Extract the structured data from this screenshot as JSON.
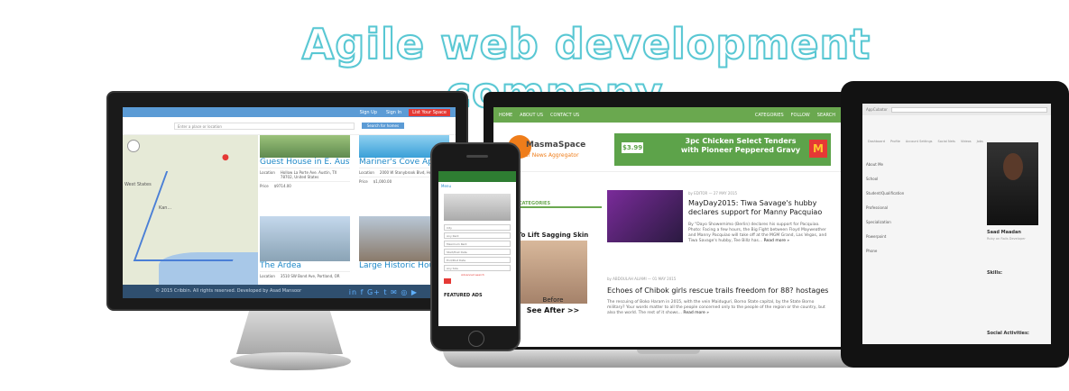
{
  "headline": "Agile web development company....",
  "monitor": {
    "nav_links": [
      "Sign Up",
      "Sign In"
    ],
    "nav_cta": "List Your Space",
    "search_placeholder": "Enter a place or location",
    "search_button": "Search for homes",
    "map_labels": [
      "West States",
      "Kan..."
    ],
    "listings": [
      {
        "title": "Guest House in E. Austin",
        "location_label": "Location",
        "location": "Hollow La Porte Ave. Austin, TX 78702, United States",
        "price_label": "Price",
        "price": "$9714.00"
      },
      {
        "title": "Mariner's Cove Apartments",
        "location_label": "Location",
        "location": "2000 W Stonybrook Blvd, Houston, TX",
        "price_label": "Price",
        "price": "$1,000.00"
      },
      {
        "title": "The Ardea",
        "location_label": "Location",
        "location": "3510 SW Bond Ave, Portland, OR",
        "price_label": "",
        "price": ""
      },
      {
        "title": "Large Historic House in...",
        "location_label": "",
        "location": "",
        "price_label": "",
        "price": ""
      }
    ],
    "footer_text": "© 2015 Cribbin. All rights reserved. Developed by Asad Mansoor",
    "social": "in f G+ t ✉ ◎ ▶"
  },
  "laptop": {
    "nav_left": [
      "HOME",
      "ABOUT US",
      "CONTACT US"
    ],
    "nav_right": [
      "CATEGORIES",
      "FOLLOW",
      "SEARCH"
    ],
    "brand": "MasmaSpace",
    "tagline": "Your News Aggregator",
    "ad_price": "$3.99",
    "ad_text": "3pc Chicken Select Tenders with Pioneer Peppered Gravy",
    "ad_logo": "M",
    "sidebar_heading": "CATEGORIES",
    "article1": {
      "byline": "by EDITOR — 27 MAY 2015",
      "title": "MayDay2015: Tiwa Savage's hubby declares support for Manny Pacquiao",
      "body": "By \"Dayo Showemimo (Berlin) declares his support for Pacquiao. Photo: Facing a few hours, the Big Fight between Floyd Mayweather and Manny Pacquiao will take off at the MGM Grand, Las Vegas, and Tiwa Savage's hubby, Tee Billz has...",
      "more": "Read more »"
    },
    "article2": {
      "byline": "by ABDOULAH ALIAMI — 01 MAY 2015",
      "title": "Echoes of Chibok girls rescue trails freedom for 88? hostages",
      "body": "The rescuing of Boko Haram in 2015, with the vein Maiduguri, Borno State capital, by the State Borno military? Your words matter to all the people concerned only to the people of the region or the country, but also the world. The rest of it shows...",
      "more": "Read more »"
    }
  },
  "skin_ad": {
    "heading": "To Lift Sagging Skin",
    "before": "Before",
    "see_after": "See After >>"
  },
  "phone": {
    "menu": "Menu",
    "fields": [
      "City",
      "Any Rent",
      "Maximum Rent",
      "Start/Post Date",
      "End/Post Date",
      "Any Size"
    ],
    "btn_label": "Advanced search",
    "featured": "FEATURED ADS"
  },
  "tablet": {
    "app_name": "AppCubator",
    "search_placeholder": "Search for jobs, projects, startup ideas, tips, people and more...",
    "tabs": [
      "Dashboard",
      "Profile",
      "Account Settings",
      "Social Nets",
      "Videos",
      "Jobs"
    ],
    "labels": [
      "About Me",
      "School",
      "Student/Qualification",
      "Professional",
      "Specialization",
      "Powerpoint",
      "Phone"
    ],
    "name": "Saad Maadan",
    "role": "Ruby on Rails Developer",
    "skills_heading": "Skills:",
    "social_heading": "Social Activities:"
  },
  "colors": {
    "headline_outline": "#58c7d3",
    "monitor_nav": "#5b9bd5",
    "laptop_nav": "#6aa84f",
    "phone_nav": "#2e7d32",
    "link_blue": "#1e88c7",
    "accent_red": "#e53935",
    "accent_orange": "#ef7d1a"
  }
}
